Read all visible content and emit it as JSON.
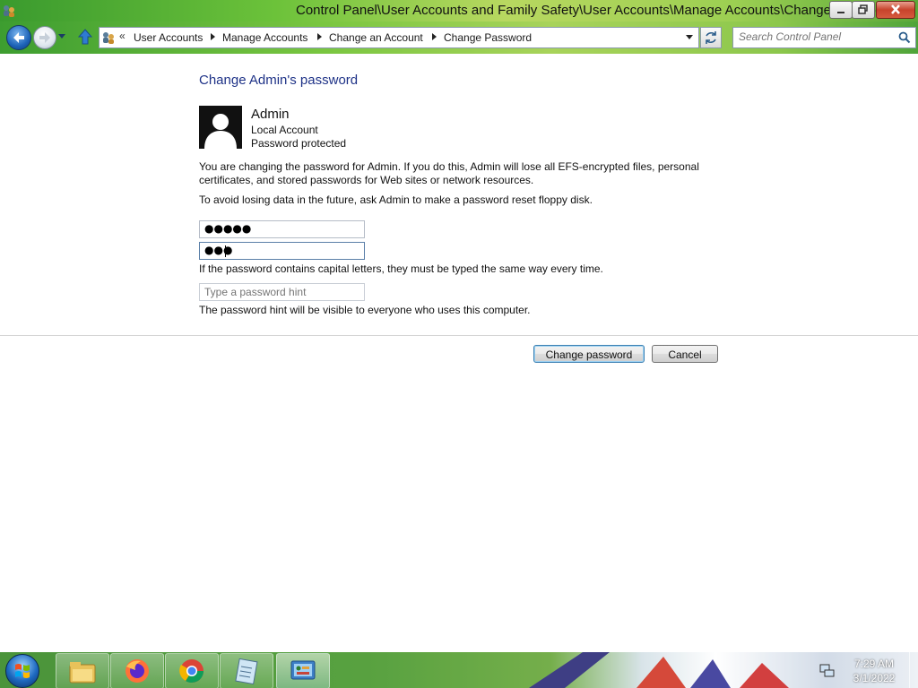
{
  "window": {
    "title": "Control Panel\\User Accounts and Family Safety\\User Accounts\\Manage Accounts\\Change an Account\\C"
  },
  "address": {
    "overflow": "«",
    "crumbs": [
      "User Accounts",
      "Manage Accounts",
      "Change an Account",
      "Change Password"
    ]
  },
  "search": {
    "placeholder": "Search Control Panel"
  },
  "content": {
    "title": "Change Admin's password",
    "account_name": "Admin",
    "account_type": "Local Account",
    "account_status": "Password protected",
    "warning_line1": "You are changing the password for Admin.  If you do this, Admin will lose all EFS-encrypted files, personal",
    "warning_line2": "certificates, and stored passwords for Web sites or network resources.",
    "advice": "To avoid losing data in the future, ask Admin to make a password reset floppy disk.",
    "new_password_masked": "●●●●●",
    "confirm_password_masked": "●●●",
    "case_note": "If the password contains capital letters, they must be typed the same way every time.",
    "hint_placeholder": "Type a password hint",
    "hint_note": "The password hint will be visible to everyone who uses this computer."
  },
  "buttons": {
    "change": "Change password",
    "cancel": "Cancel"
  },
  "taskbar": {
    "apps": [
      "file-explorer-icon",
      "firefox-icon",
      "chrome-icon",
      "notepad-icon",
      "control-panel-icon"
    ],
    "time": "7:29 AM",
    "date": "3/1/2022"
  }
}
